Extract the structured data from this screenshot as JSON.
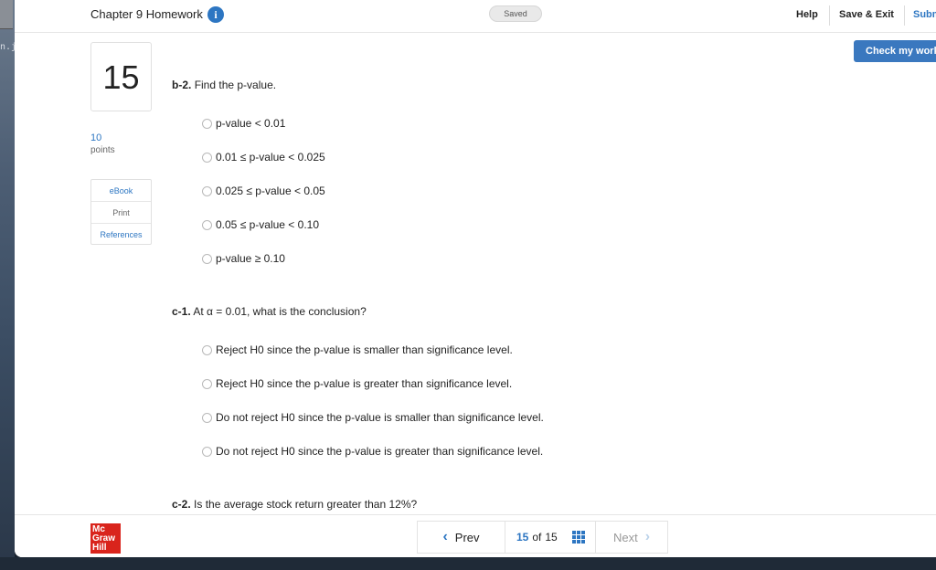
{
  "header": {
    "title": "Chapter 9 Homework",
    "status": "Saved",
    "help": "Help",
    "save_exit": "Save & Exit",
    "submit": "Submit",
    "check_work": "Check my work"
  },
  "question": {
    "number": "15",
    "points_value": "10",
    "points_label": "points"
  },
  "resources": [
    "eBook",
    "Print",
    "References"
  ],
  "part_b2": {
    "label": "b-2.",
    "prompt": "Find the p-value.",
    "options": [
      "p-value < 0.01",
      "0.01 ≤ p-value < 0.025",
      "0.025 ≤ p-value < 0.05",
      "0.05 ≤ p-value < 0.10",
      "p-value ≥ 0.10"
    ]
  },
  "part_c1": {
    "label": "c-1.",
    "prompt": "At α = 0.01, what is the conclusion?",
    "options": [
      "Reject H0 since the p-value is smaller than significance level.",
      "Reject H0 since the p-value is greater than significance level.",
      "Do not reject H0 since the p-value is smaller than significance level.",
      "Do not reject H0 since the p-value is greater than significance level."
    ]
  },
  "part_c2": {
    "label": "c-2.",
    "prompt": "Is the average stock return greater than 12%?"
  },
  "footer": {
    "logo_lines": [
      "Mc",
      "Graw",
      "Hill"
    ],
    "prev": "Prev",
    "page_current": "15",
    "page_of": "of",
    "page_total": "15",
    "next": "Next"
  },
  "colors": {
    "accent": "#2d76c2",
    "button": "#3a78bf",
    "logo": "#d9241c"
  }
}
